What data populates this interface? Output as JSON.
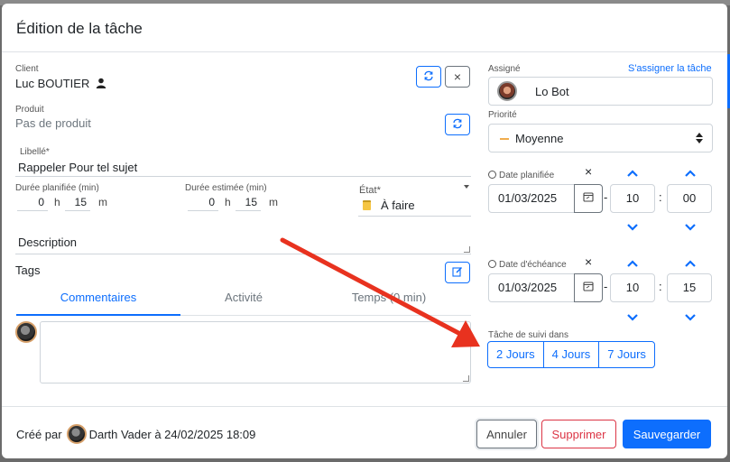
{
  "modal": {
    "title": "Édition de la tâche"
  },
  "client": {
    "label": "Client",
    "value": "Luc BOUTIER"
  },
  "produit": {
    "label": "Produit",
    "value": "Pas de produit"
  },
  "libelle": {
    "label": "Libellé*",
    "value": "Rappeler Pour tel sujet"
  },
  "duree_planifiee": {
    "label": "Durée planifiée (min)",
    "hours": "0",
    "h_unit": "h",
    "minutes": "15",
    "m_unit": "m"
  },
  "duree_estimee": {
    "label": "Durée estimée (min)",
    "hours": "0",
    "h_unit": "h",
    "minutes": "15",
    "m_unit": "m"
  },
  "etat": {
    "label": "État*",
    "value": "À faire"
  },
  "description": {
    "label": "Description"
  },
  "tags": {
    "label": "Tags"
  },
  "tabs": [
    {
      "label": "Commentaires",
      "active": true
    },
    {
      "label": "Activité",
      "active": false
    },
    {
      "label": "Temps (0 min)",
      "active": false
    }
  ],
  "assigne": {
    "label": "Assigné",
    "self_assign_link": "S'assigner la tâche",
    "value": "Lo Bot"
  },
  "priorite": {
    "label": "Priorité",
    "value": "Moyenne",
    "color": "#f0ad4e"
  },
  "date_planifiee": {
    "label": "Date planifiée",
    "date": "01/03/2025",
    "hour": "10",
    "minute": "00",
    "clear": "×"
  },
  "date_echeance": {
    "label": "Date d'échéance",
    "date": "01/03/2025",
    "hour": "10",
    "minute": "15",
    "clear": "×"
  },
  "time_separator": ":",
  "suivi": {
    "label": "Tâche de suivi dans",
    "options": [
      "2 Jours",
      "4 Jours",
      "7 Jours"
    ]
  },
  "footer": {
    "created_prefix": "Créé par",
    "created_by": "Darth Vader à 24/02/2025 18:09",
    "cancel": "Annuler",
    "delete": "Supprimer",
    "save": "Sauvegarder"
  },
  "colors": {
    "primary": "#0d6efd",
    "danger": "#dc3545",
    "annotation_arrow": "#e8321f"
  }
}
